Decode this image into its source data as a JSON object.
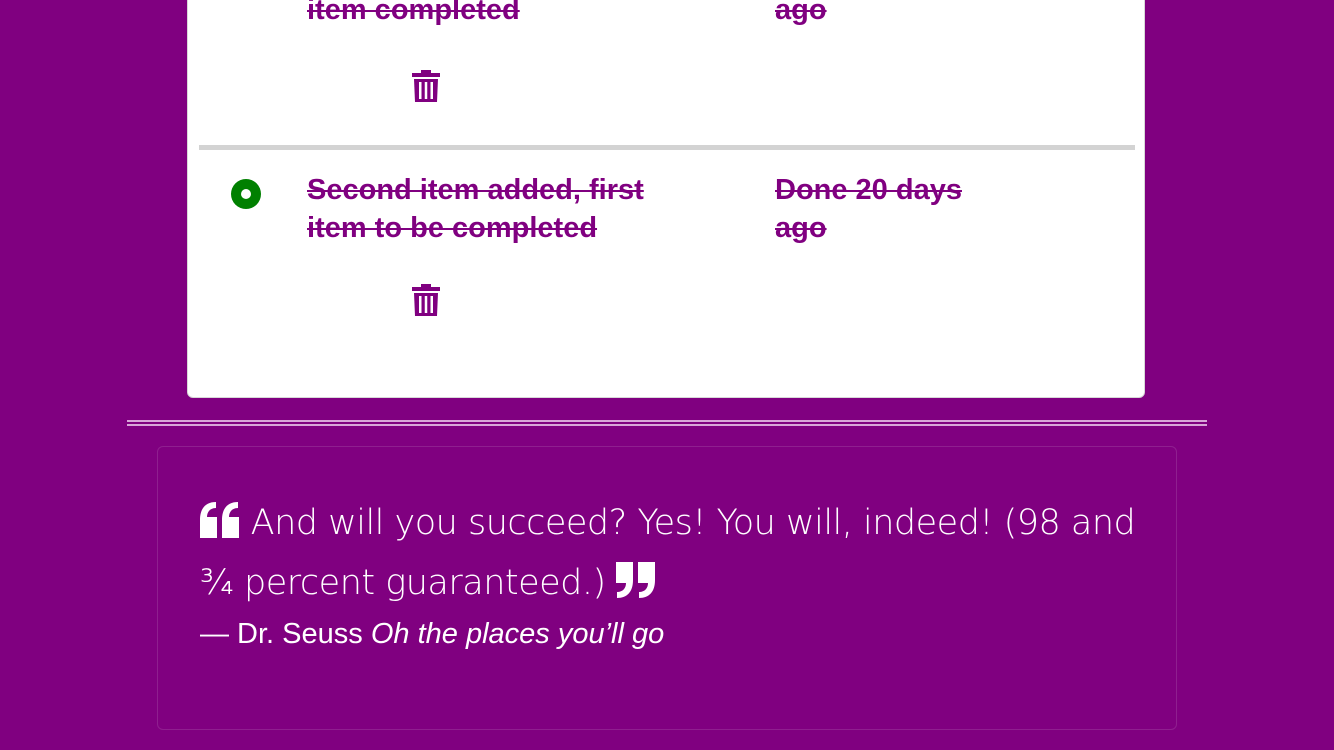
{
  "todo_items": [
    {
      "text": "item completed",
      "when": "ago",
      "done": true
    },
    {
      "text": "Second item added, first item to be completed",
      "when": "Done 20 days ago",
      "done": true
    }
  ],
  "icons": {
    "delete": "trash-icon",
    "done": "done-indicator",
    "quote_open": "quote-open-icon",
    "quote_close": "quote-close-icon"
  },
  "quote": {
    "text": "And will you succeed? Yes! You will, indeed! (98 and ¾ percent guaranteed.)",
    "author": "— Dr. Seuss",
    "work": "Oh the places you’ll go"
  },
  "colors": {
    "background": "#800080",
    "done_green": "#008000",
    "item_text": "#800080"
  }
}
